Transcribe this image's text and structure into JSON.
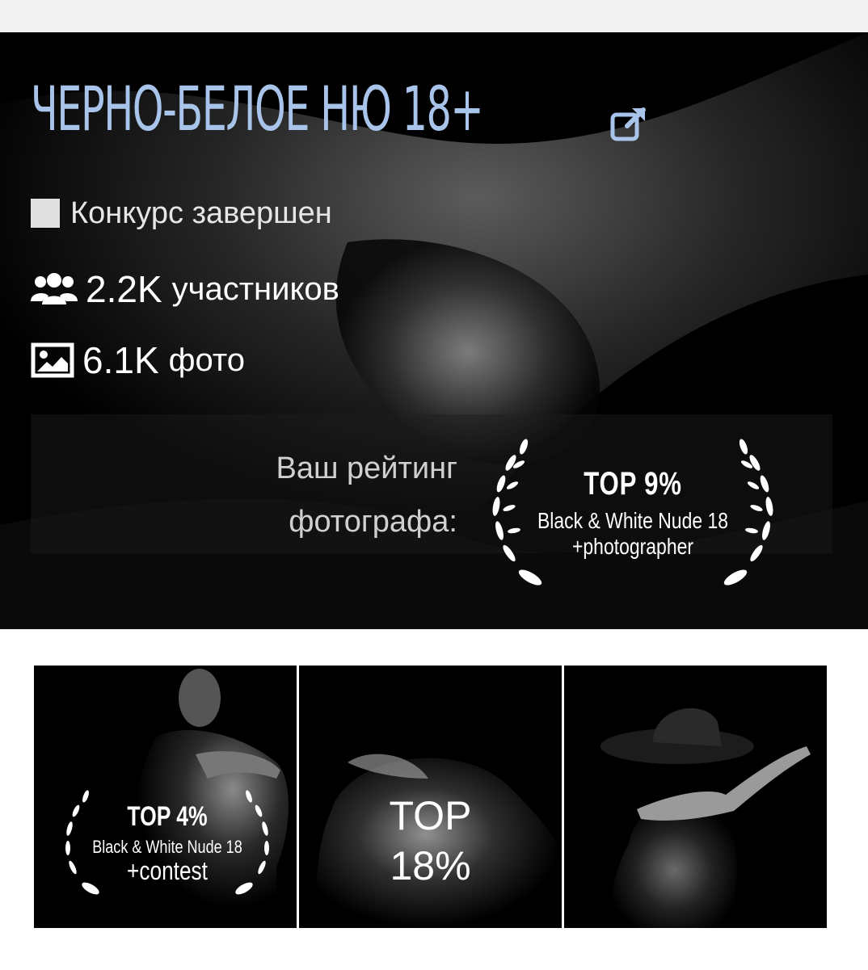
{
  "contest": {
    "title": "ЧЕРНО-БЕЛОЕ НЮ 18+",
    "status": "Конкурс завершен",
    "members_count": "2.2K",
    "members_label": "участников",
    "photos_count": "6.1K",
    "photos_label": "фото"
  },
  "rating": {
    "label_line1": "Ваш рейтинг",
    "label_line2": "фотографа:",
    "badge_top": "TOP 9%",
    "badge_line1": "Black & White Nude 18",
    "badge_line2": "+photographer"
  },
  "photos": [
    {
      "badge_top": "TOP 4%",
      "badge_line1": "Black & White Nude 18",
      "badge_line2": "+contest"
    },
    {
      "top_line1": "TOP",
      "top_line2": "18%"
    },
    {}
  ],
  "icons": {
    "external_link": "external-link-icon",
    "members": "users-icon",
    "photos": "image-icon",
    "laurel": "laurel-wreath-icon"
  },
  "colors": {
    "title": "#a9c4ea",
    "hero_bg": "#000000",
    "topbar": "#f2f2f2"
  }
}
